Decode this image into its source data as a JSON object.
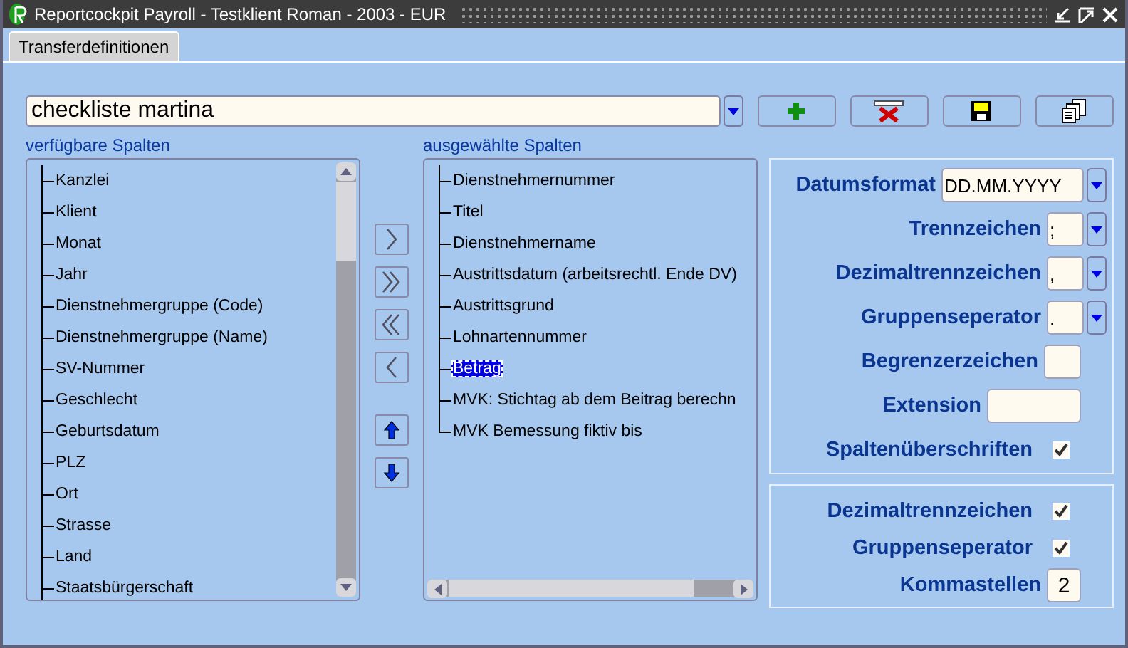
{
  "window": {
    "title": "Reportcockpit Payroll - Testklient Roman - 2003 - EUR"
  },
  "tabs": [
    {
      "label": "Transferdefinitionen",
      "selected": true
    }
  ],
  "definition": {
    "value": "checkliste martina"
  },
  "toolbar": [
    {
      "kind": "add"
    },
    {
      "kind": "delete"
    },
    {
      "kind": "save"
    },
    {
      "kind": "copy"
    }
  ],
  "available_columns": {
    "label": "verfügbare Spalten",
    "items": [
      {
        "label": "Kanzlei",
        "selected": false
      },
      {
        "label": "Klient",
        "selected": false
      },
      {
        "label": "Monat",
        "selected": false
      },
      {
        "label": "Jahr",
        "selected": false
      },
      {
        "label": "Dienstnehmergruppe (Code)",
        "selected": false
      },
      {
        "label": "Dienstnehmergruppe (Name)",
        "selected": false
      },
      {
        "label": "SV-Nummer",
        "selected": false
      },
      {
        "label": "Geschlecht",
        "selected": false
      },
      {
        "label": "Geburtsdatum",
        "selected": false
      },
      {
        "label": "PLZ",
        "selected": false
      },
      {
        "label": "Ort",
        "selected": false
      },
      {
        "label": "Strasse",
        "selected": false
      },
      {
        "label": "Land",
        "selected": false
      },
      {
        "label": "Staatsbürgerschaft",
        "selected": false
      }
    ]
  },
  "transfer_buttons": [
    {
      "kind": "add"
    },
    {
      "kind": "add_all"
    },
    {
      "kind": "remove_all"
    },
    {
      "kind": "remove"
    },
    {
      "kind": "up"
    },
    {
      "kind": "down"
    }
  ],
  "selected_columns": {
    "label": "ausgewählte Spalten",
    "items": [
      {
        "label": "Dienstnehmernummer",
        "selected": false
      },
      {
        "label": "Titel",
        "selected": false
      },
      {
        "label": "Dienstnehmername",
        "selected": false
      },
      {
        "label": "Austrittsdatum (arbeitsrechtl. Ende DV)",
        "selected": false
      },
      {
        "label": "Austrittsgrund",
        "selected": false
      },
      {
        "label": "Lohnartennummer",
        "selected": false
      },
      {
        "label": "Betrag",
        "selected": true
      },
      {
        "label": "MVK: Stichtag ab dem Beitrag berechn",
        "selected": false
      },
      {
        "label": "MVK Bemessung fiktiv bis",
        "selected": false
      }
    ]
  },
  "format_settings": [
    {
      "label": "Datumsformat",
      "kind": "dropdown",
      "value": "DD.MM.YYYY"
    },
    {
      "label": "Trennzeichen",
      "kind": "dropdown",
      "value": ";"
    },
    {
      "label": "Dezimaltrennzeichen",
      "kind": "dropdown",
      "value": ","
    },
    {
      "label": "Gruppenseperator",
      "kind": "dropdown",
      "value": "."
    },
    {
      "label": "Begrenzerzeichen",
      "kind": "char"
    },
    {
      "label": "Extension",
      "kind": "text"
    },
    {
      "label": "Spaltenüberschriften",
      "kind": "checkbox",
      "checked": true
    }
  ],
  "number_settings": [
    {
      "label": "Dezimaltrennzeichen",
      "kind": "checkbox",
      "checked": true
    },
    {
      "label": "Gruppenseperator",
      "kind": "checkbox",
      "checked": true
    },
    {
      "label": "Kommastellen",
      "kind": "number",
      "value": "2"
    }
  ]
}
